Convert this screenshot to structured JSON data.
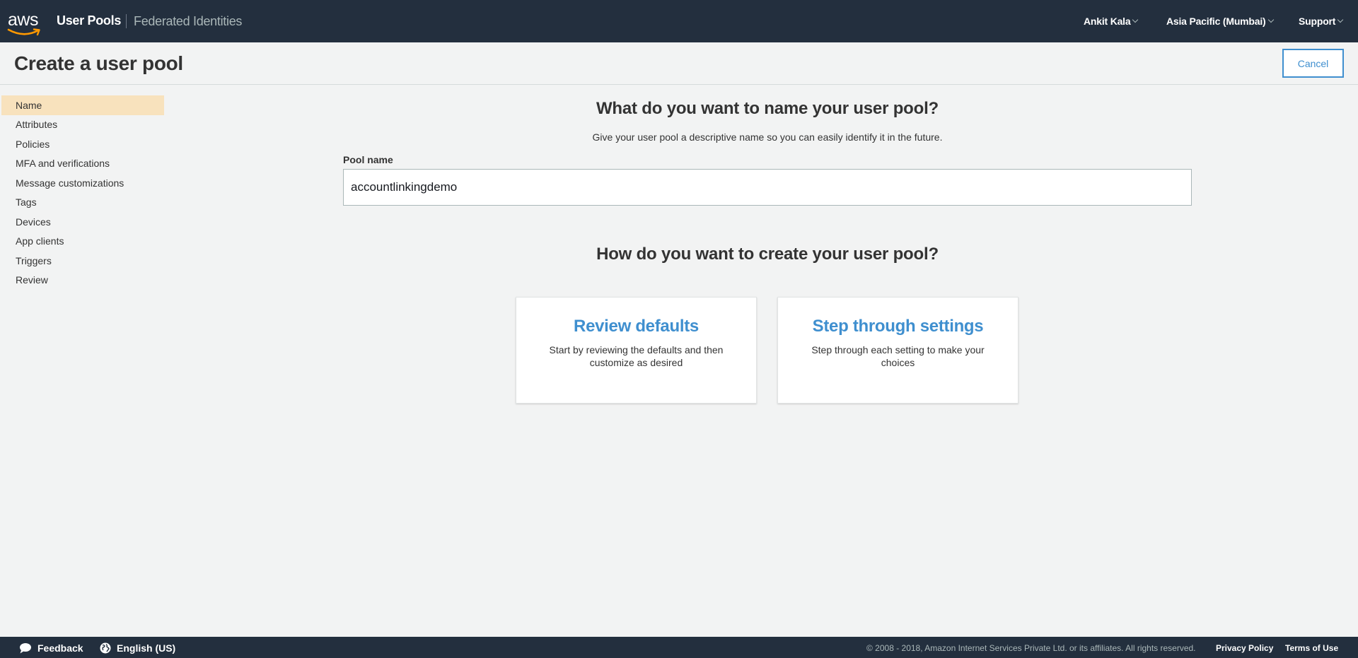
{
  "nav": {
    "logo_text": "aws",
    "user_pools": "User Pools",
    "federated_identities": "Federated Identities",
    "user": "Ankit Kala",
    "region": "Asia Pacific (Mumbai)",
    "support": "Support"
  },
  "header": {
    "title": "Create a user pool",
    "cancel_label": "Cancel"
  },
  "sidebar": {
    "items": [
      {
        "label": "Name",
        "active": true
      },
      {
        "label": "Attributes"
      },
      {
        "label": "Policies"
      },
      {
        "label": "MFA and verifications"
      },
      {
        "label": "Message customizations"
      },
      {
        "label": "Tags"
      },
      {
        "label": "Devices"
      },
      {
        "label": "App clients"
      },
      {
        "label": "Triggers"
      },
      {
        "label": "Review"
      }
    ]
  },
  "main": {
    "name_heading": "What do you want to name your user pool?",
    "name_subheading": "Give your user pool a descriptive name so you can easily identify it in the future.",
    "pool_name_label": "Pool name",
    "pool_name_value": "accountlinkingdemo",
    "create_heading": "How do you want to create your user pool?",
    "cards": [
      {
        "title": "Review defaults",
        "description": "Start by reviewing the defaults and then customize as desired"
      },
      {
        "title": "Step through settings",
        "description": "Step through each setting to make your choices"
      }
    ]
  },
  "footer": {
    "feedback": "Feedback",
    "language": "English (US)",
    "copyright": "© 2008 - 2018, Amazon Internet Services Private Ltd. or its affiliates. All rights reserved.",
    "privacy": "Privacy Policy",
    "terms": "Terms of Use"
  },
  "colors": {
    "nav_bg": "#232f3e",
    "accent": "#3f8fcf",
    "active_sidebar": "#f8e2bd",
    "page_bg": "#f2f3f3",
    "aws_smile": "#ff9900"
  }
}
